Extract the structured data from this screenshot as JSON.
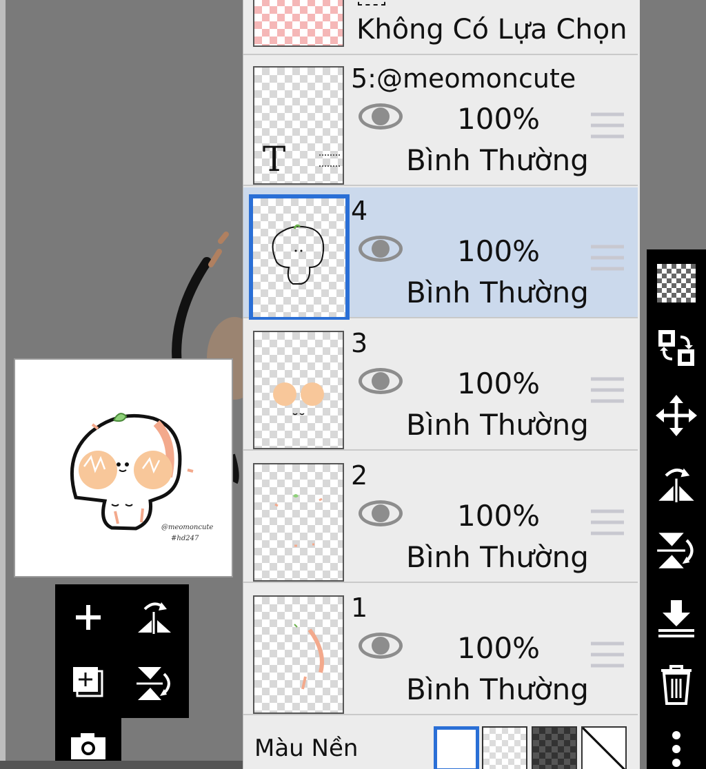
{
  "selection_row": {
    "label": "Không Có Lựa Chọn"
  },
  "layers": [
    {
      "name": "5:@meomoncute",
      "opacity": "100%",
      "blend": "Bình Thường",
      "selected": false
    },
    {
      "name": "4",
      "opacity": "100%",
      "blend": "Bình Thường",
      "selected": true
    },
    {
      "name": "3",
      "opacity": "100%",
      "blend": "Bình Thường",
      "selected": false
    },
    {
      "name": "2",
      "opacity": "100%",
      "blend": "Bình Thường",
      "selected": false
    },
    {
      "name": "1",
      "opacity": "100%",
      "blend": "Bình Thường",
      "selected": false
    }
  ],
  "layer5_thumb_glyph": "T",
  "background": {
    "label": "Màu Nền"
  },
  "preview": {
    "watermark_line1": "@meomoncute",
    "watermark_line2": "#hd247"
  },
  "colors": {
    "selected_row": "#cbd9ec",
    "selected_border": "#2a6fd6",
    "toolbar": "#000000"
  },
  "icons": {
    "right_toolbar": [
      "checker-icon",
      "swap-icon",
      "move-icon",
      "flip-horizontal-icon",
      "flip-vertical-icon",
      "merge-down-icon",
      "trash-icon",
      "more-icon"
    ],
    "mini_toolbar": [
      "add-layer-icon",
      "flip-horizontal-icon",
      "add-copy-icon",
      "flip-vertical-icon",
      "camera-icon"
    ]
  }
}
